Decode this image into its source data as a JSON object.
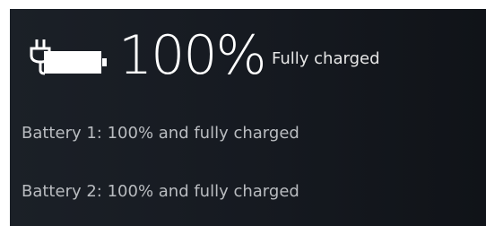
{
  "summary": {
    "icon": "battery-plugged-icon",
    "percent": "100%",
    "status": "Fully charged"
  },
  "batteries": [
    {
      "label": "Battery 1: 100% and fully charged"
    },
    {
      "label": "Battery 2: 100% and fully charged"
    }
  ],
  "colors": {
    "background": "#161a21",
    "text_primary": "#ffffff",
    "text_secondary": "#b9bcc0"
  }
}
